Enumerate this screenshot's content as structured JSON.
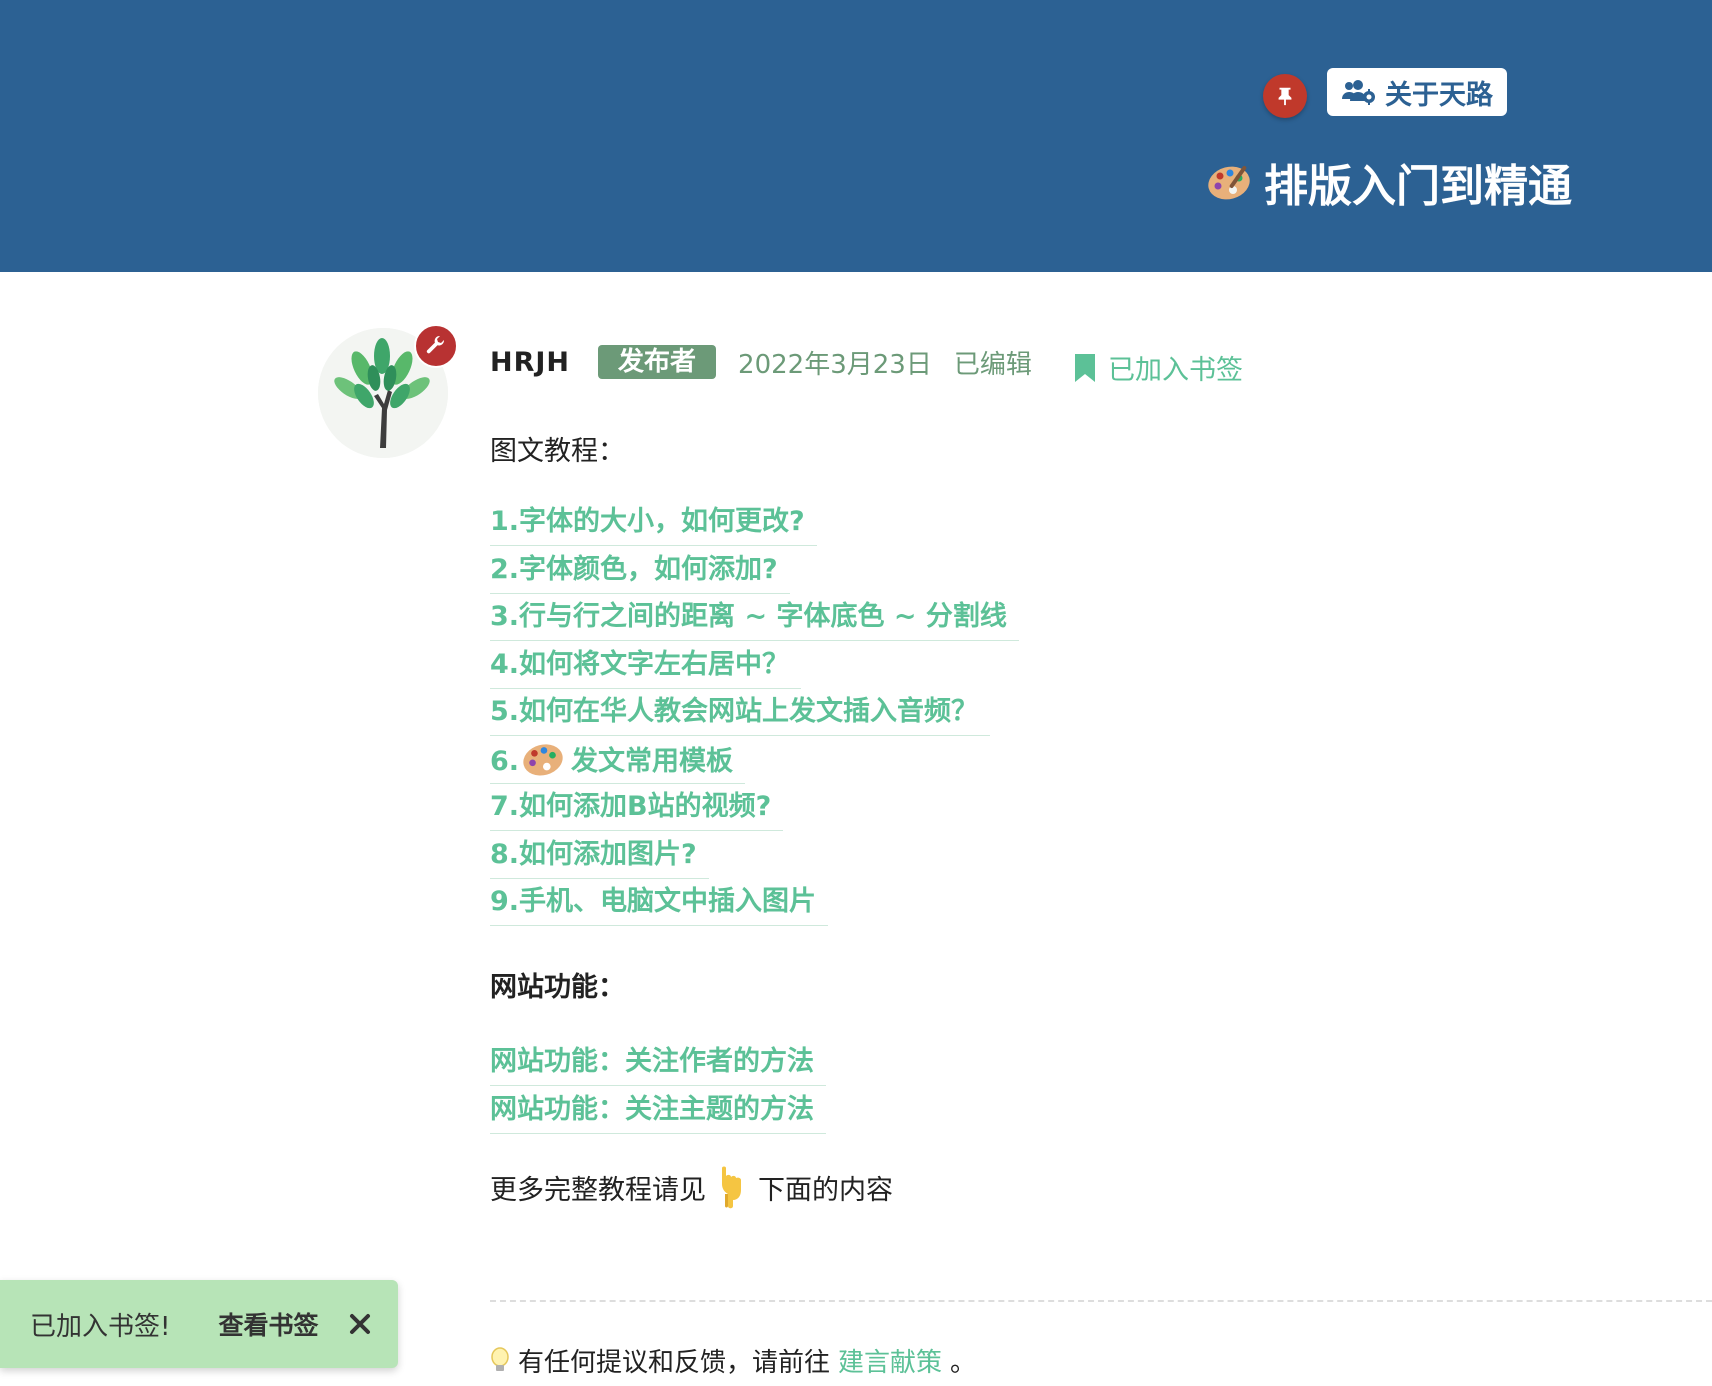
{
  "header": {
    "about_label": "关于天路",
    "topic_title": "排版入门到精通"
  },
  "post": {
    "username": "HRJH",
    "role": "发布者",
    "date": "2022年3月23日",
    "edited": "已编辑",
    "bookmark_status": "已加入书签",
    "tutorial_title": "图文教程：",
    "tutorial_links": [
      "1.字体的大小，如何更改?",
      "2.字体颜色，如何添加?",
      "3.行与行之间的距离 ~ 字体底色 ~ 分割线",
      "4.如何将文字左右居中？",
      "5.如何在华人教会网站上发文插入音频？",
      "6.",
      "7.如何添加B站的视频?",
      "8.如何添加图片?",
      "9.手机、电脑文中插入图片"
    ],
    "link6_rest": "发文常用模板",
    "features_title": "网站功能：",
    "feature_links": [
      "网站功能：关注作者的方法",
      "网站功能：关注主题的方法"
    ],
    "more_before": "更多完整教程请见",
    "more_after": "下面的内容",
    "feedback_before": "有任何提议和反馈，请前往",
    "feedback_link": "建言献策",
    "feedback_after": "。"
  },
  "toast": {
    "message": "已加入书签!",
    "view_label": "查看书签"
  },
  "colors": {
    "header_bg": "#2c6193",
    "link": "#5cc197",
    "role_badge": "#6c9a78",
    "pin": "#c0392b",
    "toast_bg": "#b7e4b7"
  },
  "icons": {
    "pin": "thumbtack-icon",
    "about": "users-gear-icon",
    "title": "palette-icon",
    "avatar_badge": "wrench-icon",
    "bookmark": "bookmark-icon",
    "pointing": "pointing-down-icon",
    "feedback": "lightbulb-icon",
    "close": "close-icon"
  }
}
